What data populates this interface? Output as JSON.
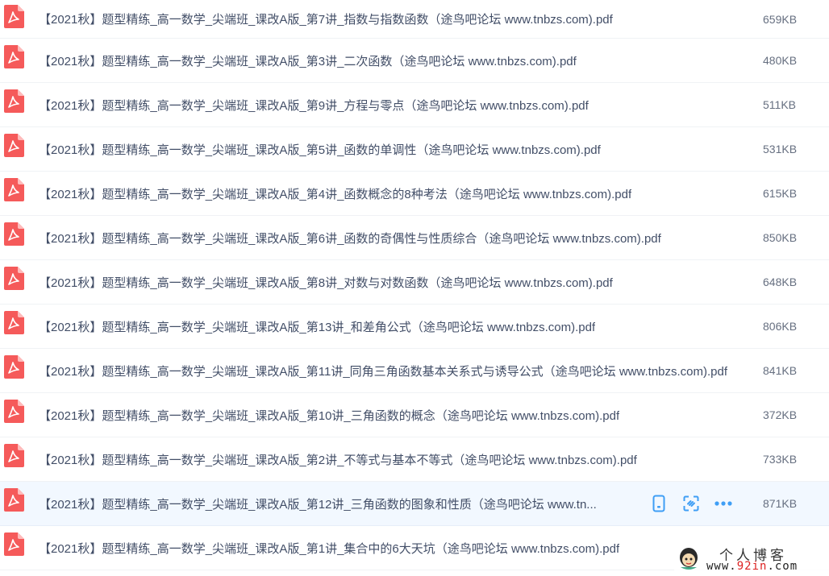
{
  "colors": {
    "pdf_red": "#f55a5a",
    "accent_blue": "#3f9ef5",
    "text": "#424e67",
    "size_text": "#666f80",
    "hover_row": "#f2f8ff"
  },
  "files": [
    {
      "name": "【2021秋】题型精练_高一数学_尖端班_课改A版_第7讲_指数与指数函数（途鸟吧论坛 www.tnbzs.com).pdf",
      "size": "659KB",
      "icon": "pdf-icon"
    },
    {
      "name": "【2021秋】题型精练_高一数学_尖端班_课改A版_第3讲_二次函数（途鸟吧论坛 www.tnbzs.com).pdf",
      "size": "480KB",
      "icon": "pdf-icon"
    },
    {
      "name": "【2021秋】题型精练_高一数学_尖端班_课改A版_第9讲_方程与零点（途鸟吧论坛 www.tnbzs.com).pdf",
      "size": "511KB",
      "icon": "pdf-icon"
    },
    {
      "name": "【2021秋】题型精练_高一数学_尖端班_课改A版_第5讲_函数的单调性（途鸟吧论坛 www.tnbzs.com).pdf",
      "size": "531KB",
      "icon": "pdf-icon"
    },
    {
      "name": "【2021秋】题型精练_高一数学_尖端班_课改A版_第4讲_函数概念的8种考法（途鸟吧论坛 www.tnbzs.com).pdf",
      "size": "615KB",
      "icon": "pdf-icon"
    },
    {
      "name": "【2021秋】题型精练_高一数学_尖端班_课改A版_第6讲_函数的奇偶性与性质综合（途鸟吧论坛 www.tnbzs.com).pdf",
      "size": "850KB",
      "icon": "pdf-icon"
    },
    {
      "name": "【2021秋】题型精练_高一数学_尖端班_课改A版_第8讲_对数与对数函数（途鸟吧论坛 www.tnbzs.com).pdf",
      "size": "648KB",
      "icon": "pdf-icon"
    },
    {
      "name": "【2021秋】题型精练_高一数学_尖端班_课改A版_第13讲_和差角公式（途鸟吧论坛 www.tnbzs.com).pdf",
      "size": "806KB",
      "icon": "pdf-icon"
    },
    {
      "name": "【2021秋】题型精练_高一数学_尖端班_课改A版_第11讲_同角三角函数基本关系式与诱导公式（途鸟吧论坛 www.tnbzs.com).pdf",
      "size": "841KB",
      "icon": "pdf-icon"
    },
    {
      "name": "【2021秋】题型精练_高一数学_尖端班_课改A版_第10讲_三角函数的概念（途鸟吧论坛 www.tnbzs.com).pdf",
      "size": "372KB",
      "icon": "pdf-icon"
    },
    {
      "name": "【2021秋】题型精练_高一数学_尖端班_课改A版_第2讲_不等式与基本不等式（途鸟吧论坛 www.tnbzs.com).pdf",
      "size": "733KB",
      "icon": "pdf-icon"
    },
    {
      "name": "【2021秋】题型精练_高一数学_尖端班_课改A版_第12讲_三角函数的图象和性质（途鸟吧论坛 www.tn...",
      "size": "871KB",
      "icon": "pdf-icon",
      "hovered": true
    },
    {
      "name": "【2021秋】题型精练_高一数学_尖端班_课改A版_第1讲_集合中的6大天坑（途鸟吧论坛 www.tnbzs.com).pdf",
      "size": "",
      "icon": "pdf-icon"
    }
  ],
  "row_actions": [
    {
      "icon": "phone-icon"
    },
    {
      "icon": "share-icon"
    },
    {
      "icon": "more-icon"
    }
  ],
  "watermark": {
    "title": "个人博客",
    "url_prefix": "www.",
    "url_highlight": "92in",
    "url_suffix": ".com"
  }
}
